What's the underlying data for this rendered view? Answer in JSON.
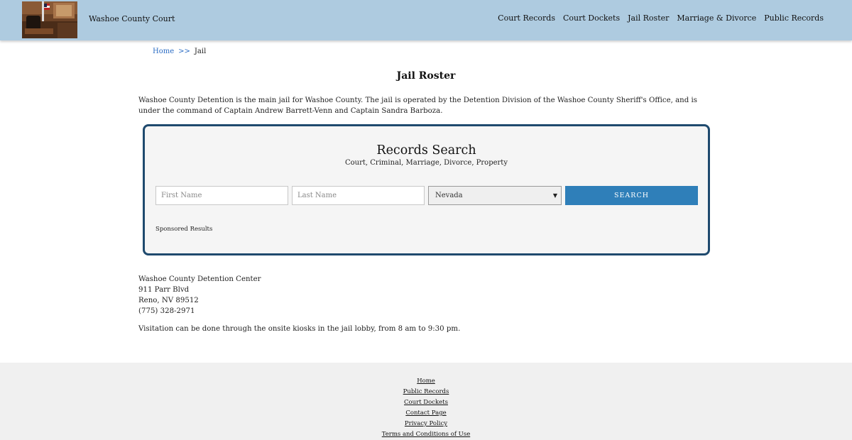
{
  "header": {
    "brand": "Washoe County Court",
    "nav": [
      "Court Records",
      "Court Dockets",
      "Jail Roster",
      "Marriage & Divorce",
      "Public Records"
    ]
  },
  "breadcrumb": {
    "home": "Home",
    "separator": ">>",
    "current": "Jail"
  },
  "page_title": "Jail Roster",
  "intro": "Washoe County Detention is the main jail for Washoe County. The jail is operated by the Detention Division of the Washoe County Sheriff's Office, and is under the command of Captain Andrew Barrett-Venn and Captain Sandra Barboza.",
  "search": {
    "title": "Records Search",
    "subtitle": "Court, Criminal, Marriage, Divorce, Property",
    "first_name_placeholder": "First Name",
    "last_name_placeholder": "Last Name",
    "state_selected": "Nevada",
    "button_label": "SEARCH",
    "sponsored": "Sponsored Results"
  },
  "address": {
    "name": "Washoe County Detention Center",
    "street": "911 Parr Blvd",
    "city": "Reno, NV 89512",
    "phone": "(775) 328-2971"
  },
  "visitation": "Visitation can be done through the onsite kiosks in the jail lobby, from 8 am to 9:30 pm.",
  "footer": {
    "links": [
      "Home",
      "Public Records",
      "Court Dockets",
      "Contact Page",
      "Privacy Policy",
      "Terms and Conditions of Use"
    ]
  },
  "colors": {
    "header_bg": "#aecbe0",
    "card_border": "#1f4a6e",
    "button_bg": "#2f7fb9",
    "link": "#2b6cc4",
    "footer_bg": "#f0f0f0"
  },
  "icons": {
    "logo": "courtroom-image"
  }
}
